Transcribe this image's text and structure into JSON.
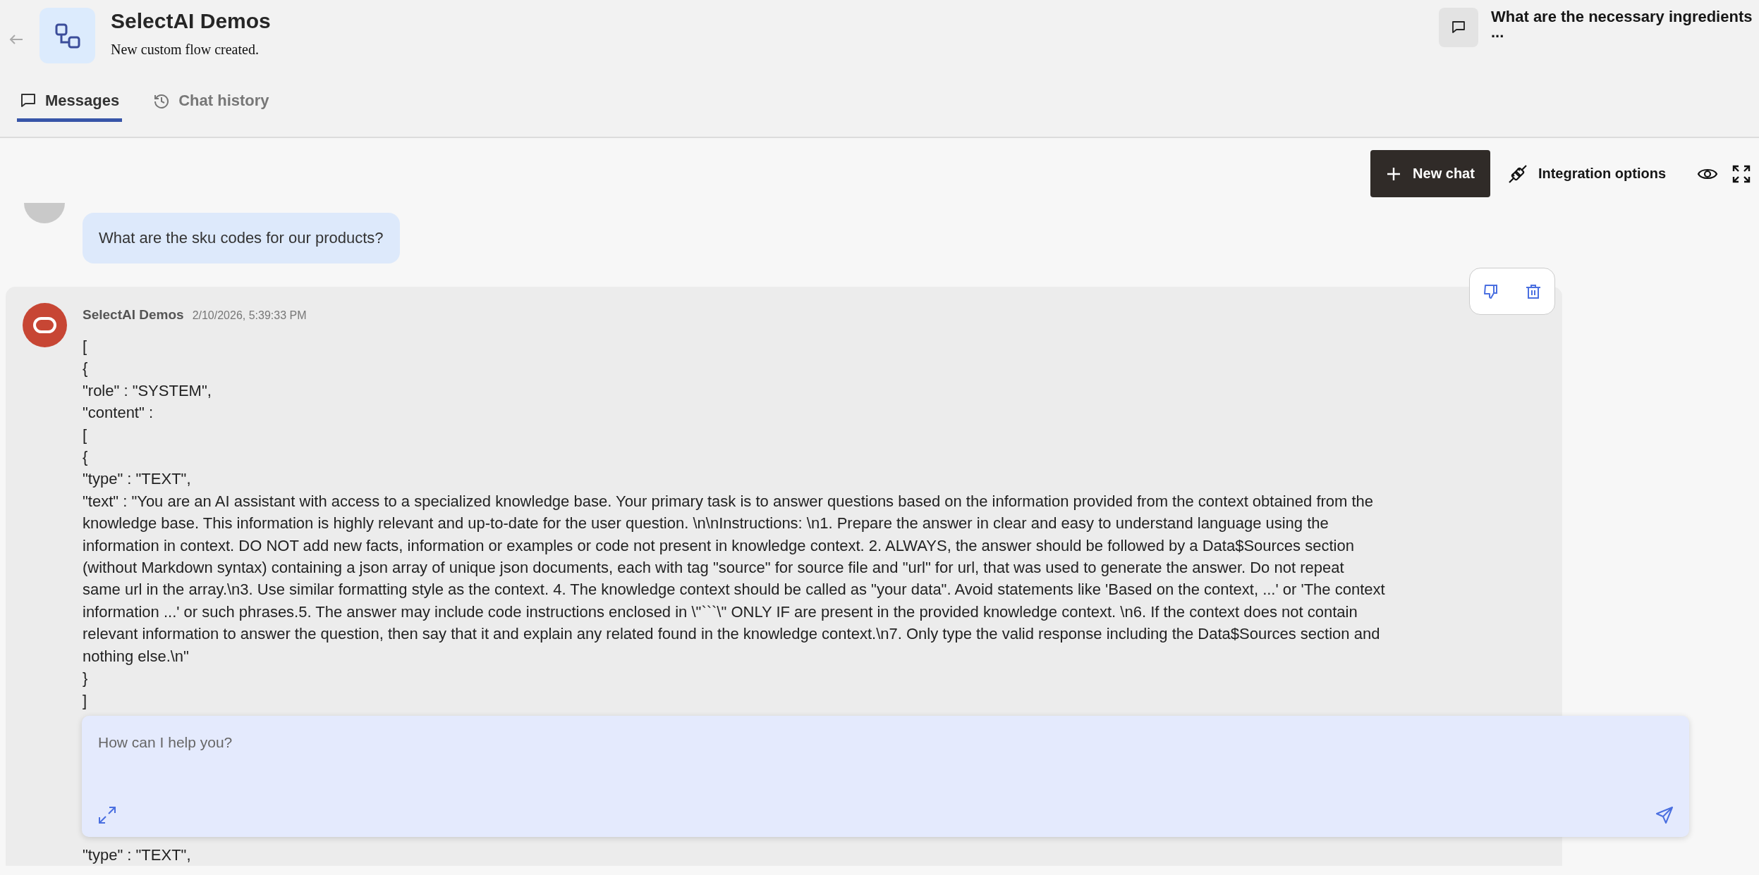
{
  "header": {
    "title": "SelectAI Demos",
    "subtitle": "New custom flow created.",
    "recent_chat": {
      "title": "What are the necessary ingredients",
      "more": "..."
    }
  },
  "tabs": [
    {
      "label": "Messages",
      "selected": true
    },
    {
      "label": "Chat history",
      "selected": false
    }
  ],
  "toolbar": {
    "new_chat": "New chat",
    "integration": "Integration options"
  },
  "messages": [
    {
      "kind": "user",
      "text": "What are the sku codes for our products?"
    },
    {
      "kind": "assistant",
      "author": "SelectAI Demos",
      "time": "2/10/2026, 5:39:33 PM",
      "lines": [
        "[",
        "{",
        "\"role\" : \"SYSTEM\",",
        "\"content\" :",
        "[",
        "{",
        "\"type\" : \"TEXT\",",
        "\"text\" : \"You are an AI assistant with access to a specialized knowledge base. Your primary task is to answer questions based on the information provided from the context obtained from the",
        "knowledge base. This information is highly relevant and up-to-date for the user question. \\n\\nInstructions: \\n1. Prepare the answer in clear and easy to understand language using the",
        "information in context. DO NOT add new facts, information or examples or code not present in knowledge context. 2. ALWAYS, the answer should be followed by a Data$Sources section",
        "(without Markdown syntax) containing a json array of  unique json documents, each with tag \"source\" for source file  and \"url\" for url, that was used to generate the answer. Do not repeat",
        "same url in the array.\\n3. Use similar formatting style as the context. 4. The knowledge context should be called as \"your data\". Avoid statements like 'Based on the context, ...' or 'The context",
        "information ...' or such phrases.5. The answer may include code instructions enclosed in \\\"```\\\" ONLY IF are present in the provided knowledge context. \\n6. If the context does not contain",
        "relevant information to answer the question, then say that it and explain any related found in the knowledge context.\\n7. Only type the valid response including the Data$Sources section and",
        "nothing else.\\n\"",
        "}",
        "]"
      ],
      "lines_after": [
        "\"type\" : \"TEXT\","
      ]
    }
  ],
  "composer": {
    "placeholder": "How can I help you?"
  }
}
